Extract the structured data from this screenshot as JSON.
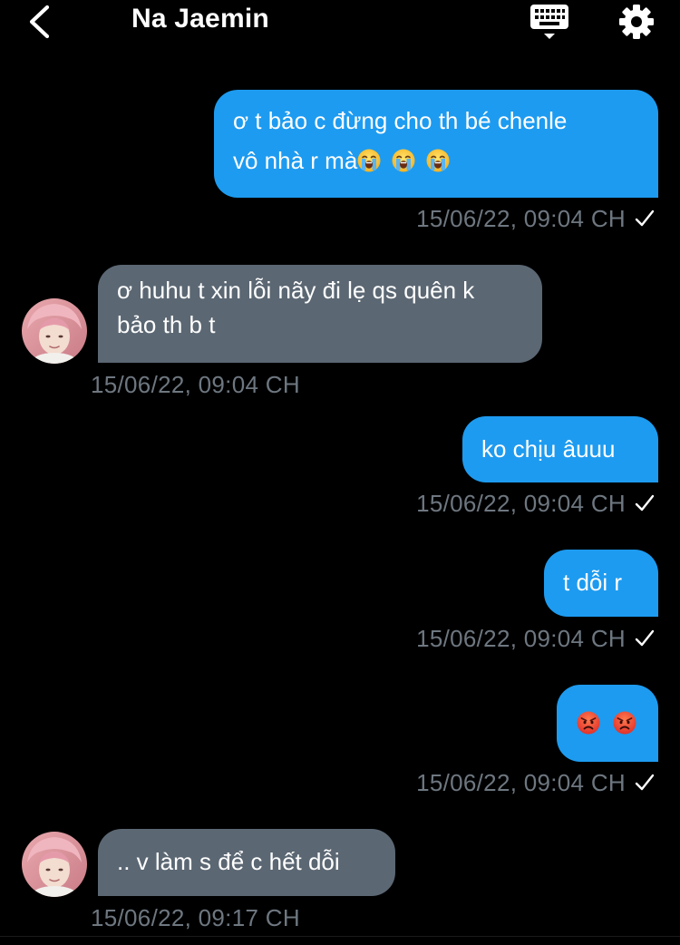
{
  "header": {
    "contact_name": "Na Jaemin",
    "back_icon": "chevron-left-icon",
    "keyboard_icon": "keyboard-icon",
    "settings_icon": "gear-icon"
  },
  "colors": {
    "outgoing_bubble": "#1d9bf0",
    "incoming_bubble": "#5b6773",
    "timestamp": "#6e7780",
    "background": "#000000"
  },
  "messages": [
    {
      "direction": "outgoing",
      "lines": [
        "ơ t bảo c đừng cho th bé chenle",
        "vô nhà r mà"
      ],
      "emojis": [
        "loudly-crying-face",
        "loudly-crying-face",
        "loudly-crying-face"
      ],
      "timestamp": "15/06/22, 09:04 CH",
      "status": "sent-check-icon"
    },
    {
      "direction": "incoming",
      "lines": [
        "ơ huhu t xin lỗi nãy đi lẹ qs quên k",
        "bảo th b t"
      ],
      "timestamp": "15/06/22, 09:04 CH"
    },
    {
      "direction": "outgoing",
      "lines": [
        "ko chịu âuuu"
      ],
      "timestamp": "15/06/22, 09:04 CH",
      "status": "sent-check-icon"
    },
    {
      "direction": "outgoing",
      "lines": [
        "t dỗi r"
      ],
      "timestamp": "15/06/22, 09:04 CH",
      "status": "sent-check-icon"
    },
    {
      "direction": "outgoing",
      "lines": [],
      "emojis": [
        "angry-face",
        "angry-face"
      ],
      "timestamp": "15/06/22, 09:04 CH",
      "status": "sent-check-icon"
    },
    {
      "direction": "incoming",
      "lines": [
        ".. v làm s để c hết dỗi"
      ],
      "timestamp": "15/06/22, 09:17 CH"
    }
  ]
}
